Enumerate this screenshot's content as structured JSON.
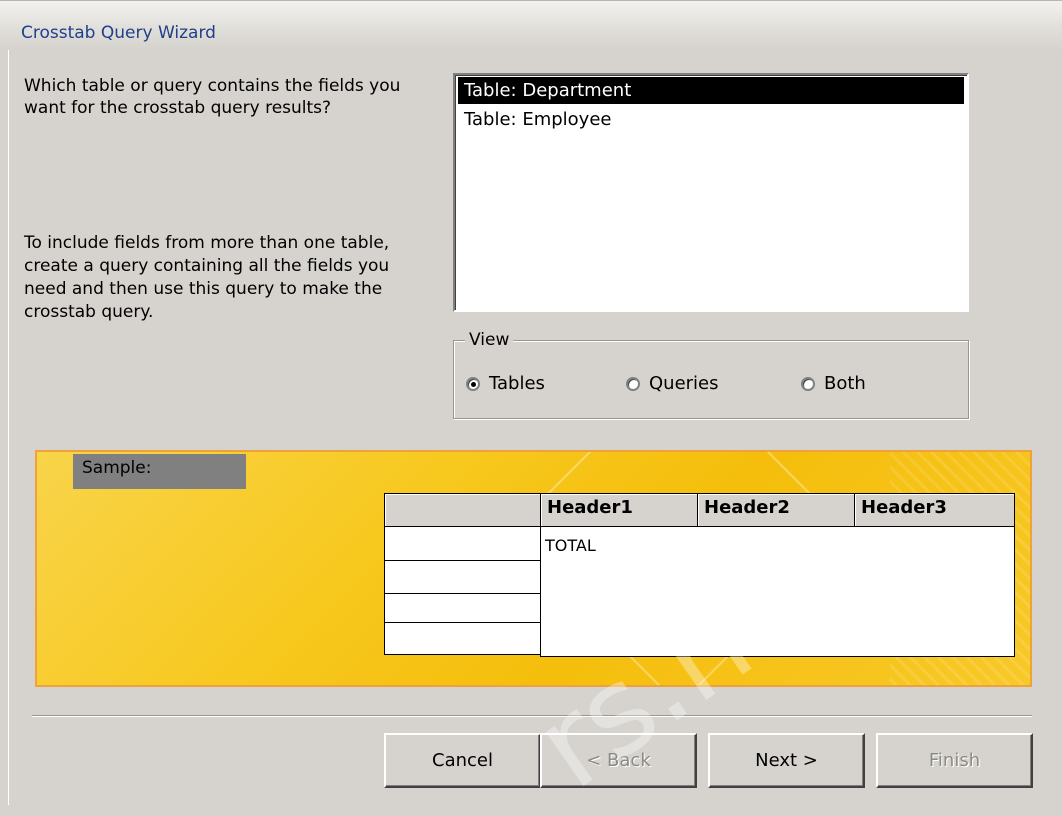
{
  "window": {
    "title": "Crosstab Query Wizard"
  },
  "prompt": "Which table or query contains the fields you want for the crosstab query results?",
  "hint": "To include fields from more than one table, create a query containing all the fields you need and then use this query to make the crosstab query.",
  "list": {
    "items": [
      {
        "label": "Table: Department",
        "selected": true
      },
      {
        "label": "Table: Employee",
        "selected": false
      }
    ]
  },
  "view": {
    "label": "View",
    "options": [
      {
        "label": "Tables",
        "selected": true
      },
      {
        "label": "Queries",
        "selected": false
      },
      {
        "label": "Both",
        "selected": false
      }
    ]
  },
  "sample": {
    "label": "Sample:",
    "headers": [
      "Header1",
      "Header2",
      "Header3"
    ],
    "total": "TOTAL"
  },
  "buttons": {
    "cancel": "Cancel",
    "back": "< Back",
    "next": "Next >",
    "finish": "Finish"
  },
  "watermark": "rs.net"
}
